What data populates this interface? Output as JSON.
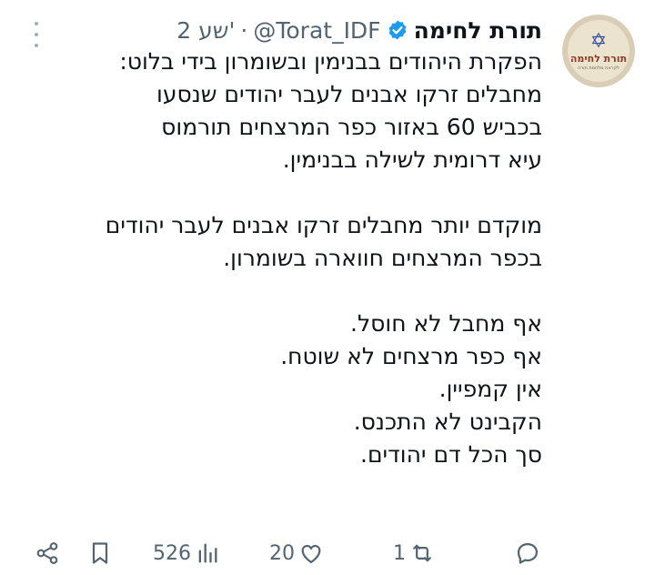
{
  "author": {
    "display_name": "תורת לחימה",
    "handle": "@Torat_IDF",
    "separator": "·",
    "time": "2 שע'",
    "avatar": {
      "logo_text": "תורת לחימה",
      "logo_sub": "לקראת מלחמת תורה",
      "icon": "star-of-david-icon"
    }
  },
  "tweet": {
    "lines": [
      "הפקרת היהודים בבנימין ובשומרון בידי בלוט:",
      "מחבלים זרקו אבנים לעבר יהודים שנסעו",
      "בכביש 60 באזור כפר המרצחים תורמוס",
      "עיא דרומית לשילה בבנימין.",
      "",
      "מוקדם יותר מחבלים זרקו אבנים לעבר יהודים",
      "בכפר המרצחים חווארה בשומרון.",
      "",
      "אף מחבל לא חוסל.",
      "אף כפר מרצחים לא שוטח.",
      "אין קמפיין.",
      "הקבינט לא התכנס.",
      "סך הכל דם יהודים."
    ]
  },
  "actions": {
    "views": "526",
    "likes": "20",
    "retweets": "1"
  },
  "colors": {
    "text": "#0f1419",
    "secondary": "#536471",
    "verified": "#1d9bf0"
  }
}
